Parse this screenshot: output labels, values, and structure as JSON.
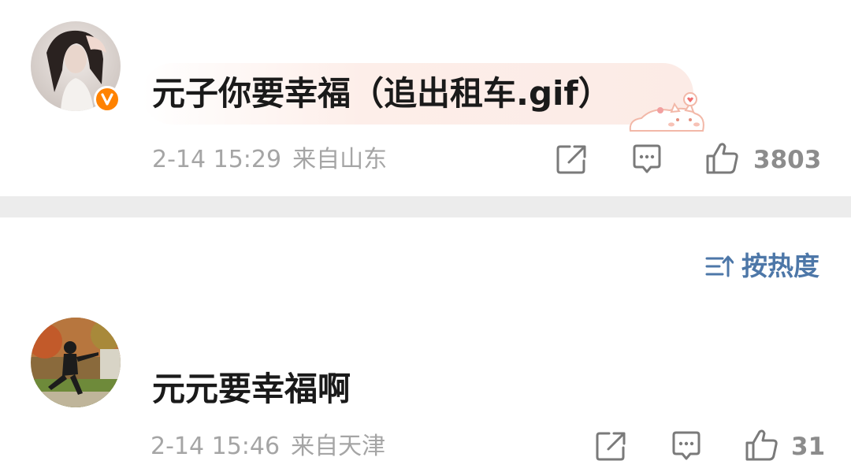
{
  "comments": [
    {
      "text": "元子你要幸福（追出租车.gif）",
      "time": "2-14 15:29",
      "location": "来自山东",
      "likes": "3803",
      "verified": true
    },
    {
      "text": "元元要幸福啊",
      "time": "2-14 15:46",
      "location": "来自天津",
      "likes": "31",
      "verified": false
    }
  ],
  "sort": {
    "label": "按热度",
    "icon": "sort-icon"
  },
  "colors": {
    "accent": "#4d77a8",
    "verified_badge": "#ff8200",
    "meta_text": "#a5a5a5",
    "divider": "#ececec"
  },
  "icons": {
    "share": "share-icon",
    "comment": "comment-icon",
    "like": "like-icon"
  }
}
